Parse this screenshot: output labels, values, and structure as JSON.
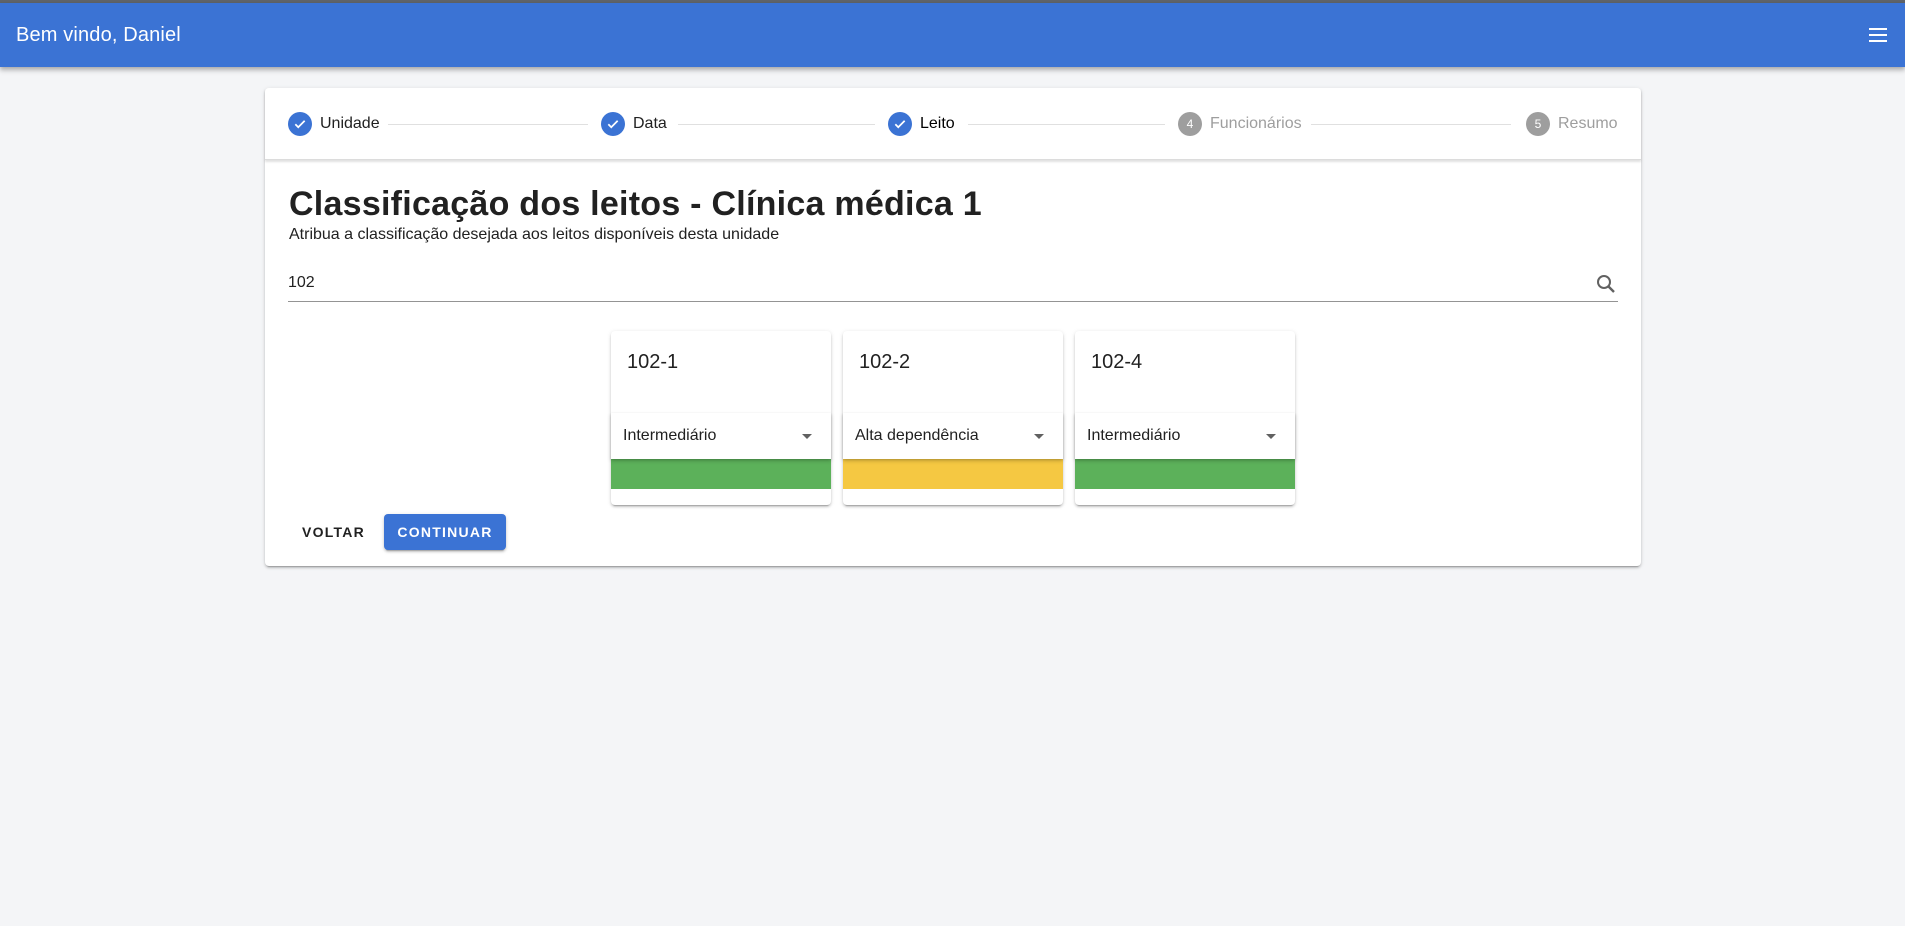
{
  "app": {
    "welcome": "Bem vindo, Daniel"
  },
  "colors": {
    "primary": "#3b73d4",
    "green": "#5cb15a",
    "yellow": "#f5c842",
    "inactive": "#9e9e9e"
  },
  "stepper": {
    "steps": [
      {
        "label": "Unidade",
        "status": "complete",
        "number": "1"
      },
      {
        "label": "Data",
        "status": "complete",
        "number": "2"
      },
      {
        "label": "Leito",
        "status": "complete-active",
        "number": "3"
      },
      {
        "label": "Funcionários",
        "status": "inactive",
        "number": "4"
      },
      {
        "label": "Resumo",
        "status": "inactive",
        "number": "5"
      }
    ]
  },
  "page": {
    "title": "Classificação dos leitos - Clínica médica 1",
    "subtitle": "Atribua a classificação desejada aos leitos disponíveis desta unidade"
  },
  "search": {
    "value": "102",
    "icon": "search-icon"
  },
  "beds": [
    {
      "name": "102-1",
      "classification": "Intermediário",
      "color": "#5cb15a"
    },
    {
      "name": "102-2",
      "classification": "Alta dependência",
      "color": "#f5c842"
    },
    {
      "name": "102-4",
      "classification": "Intermediário",
      "color": "#5cb15a"
    }
  ],
  "actions": {
    "back": "VOLTAR",
    "continue": "CONTINUAR"
  }
}
